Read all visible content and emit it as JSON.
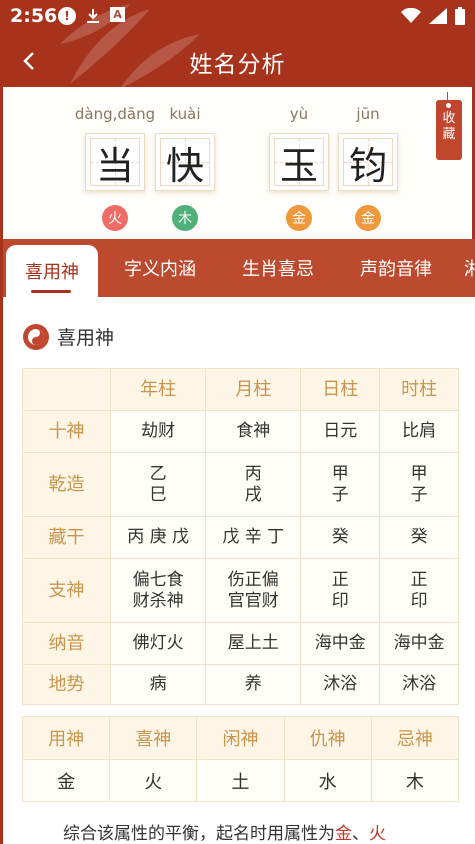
{
  "status_bar": {
    "time": "2:56",
    "notif_box_letter": "A"
  },
  "header": {
    "title": "姓名分析"
  },
  "name": {
    "chars": [
      {
        "pinyin": "dàng,dāng",
        "char": "当",
        "element": "火",
        "color": "#ef6c66"
      },
      {
        "pinyin": "kuài",
        "char": "快",
        "element": "木",
        "color": "#4fb07a"
      },
      {
        "pinyin": "yù",
        "char": "玉",
        "element": "金",
        "color": "#f0983c"
      },
      {
        "pinyin": "jūn",
        "char": "钧",
        "element": "金",
        "color": "#f0983c"
      }
    ],
    "favorite_label": "收藏"
  },
  "tabs": [
    "喜用神",
    "字义内涵",
    "生肖喜忌",
    "声韵音律",
    "湘"
  ],
  "section": {
    "title": "喜用神"
  },
  "bazi": {
    "columns": [
      "年柱",
      "月柱",
      "日柱",
      "时柱"
    ],
    "rows": [
      {
        "label": "十神",
        "cells": [
          "劫财",
          "食神",
          "日元",
          "比肩"
        ]
      },
      {
        "label": "乾造",
        "cells": [
          [
            "乙",
            "巳"
          ],
          [
            "丙",
            "戌"
          ],
          [
            "甲",
            "子"
          ],
          [
            "甲",
            "子"
          ]
        ]
      },
      {
        "label": "藏干",
        "cells": [
          "丙 庚 戊",
          "戊 辛 丁",
          "癸",
          "癸"
        ]
      },
      {
        "label": "支神",
        "cells": [
          [
            "偏七食",
            "财杀神"
          ],
          [
            "伤正偏",
            "官官财"
          ],
          [
            "正",
            "印"
          ],
          [
            "正",
            "印"
          ]
        ]
      },
      {
        "label": "纳音",
        "cells": [
          "佛灯火",
          "屋上土",
          "海中金",
          "海中金"
        ]
      },
      {
        "label": "地势",
        "cells": [
          "病",
          "养",
          "沐浴",
          "沐浴"
        ]
      }
    ]
  },
  "gods": {
    "headers": [
      "用神",
      "喜神",
      "闲神",
      "仇神",
      "忌神"
    ],
    "values": [
      "金",
      "火",
      "土",
      "水",
      "木"
    ]
  },
  "summary": {
    "prefix": "综合该属性的平衡，起名时用属性为",
    "hl1": "金",
    "sep": "、",
    "hl2": "火"
  }
}
